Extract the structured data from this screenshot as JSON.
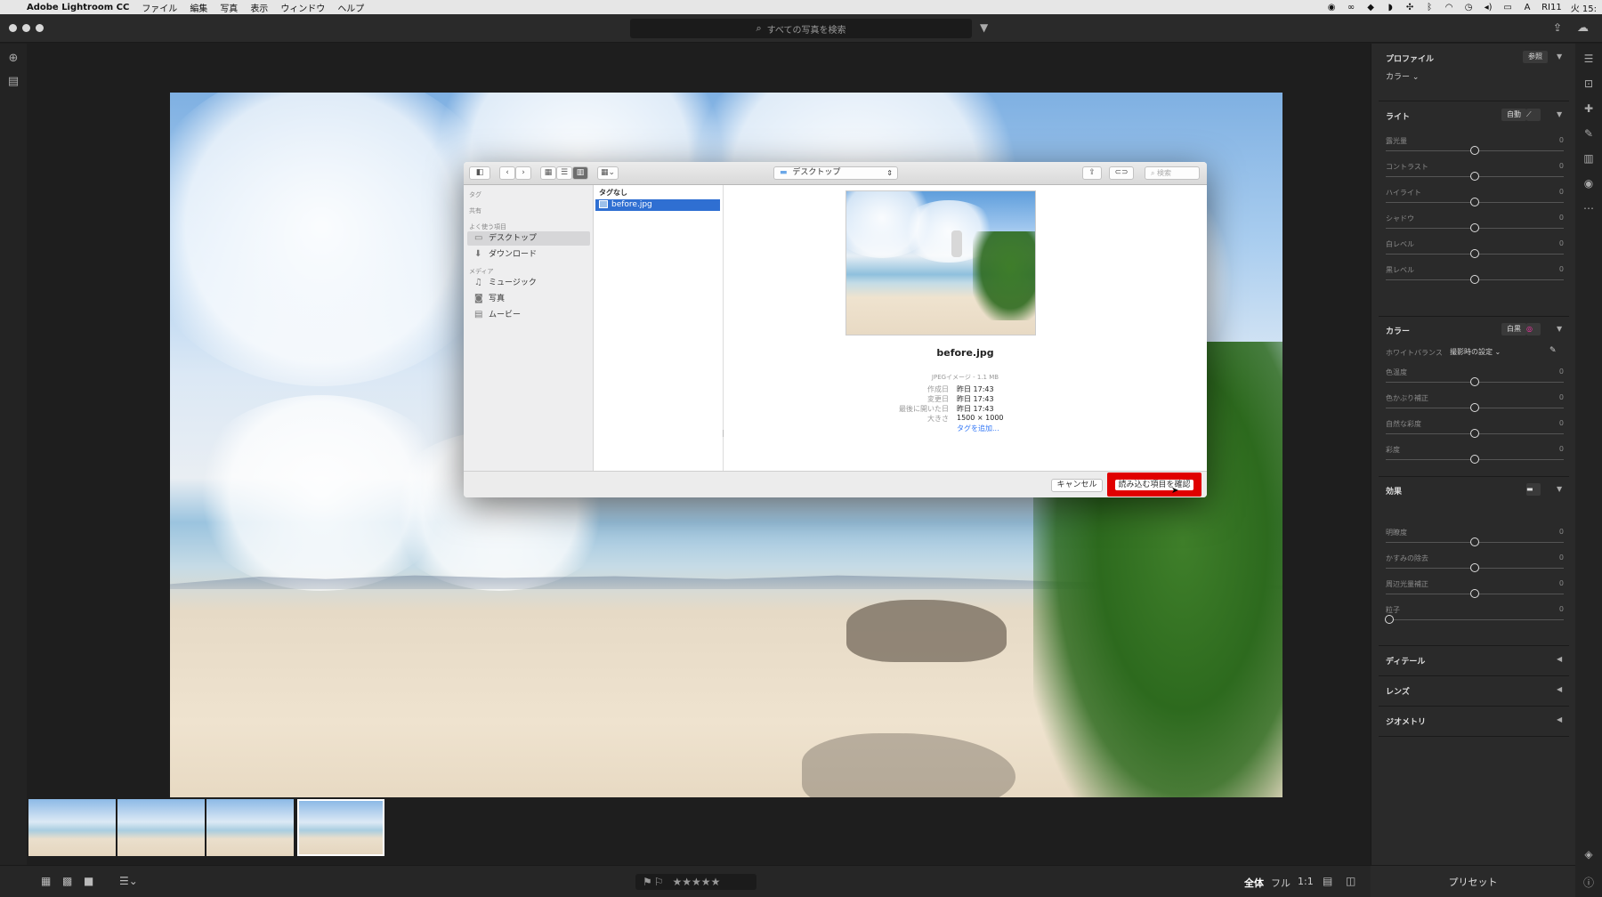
{
  "menubar": {
    "app_name": "Adobe Lightroom CC",
    "menus": [
      "ファイル",
      "編集",
      "写真",
      "表示",
      "ウィンドウ",
      "ヘルプ"
    ],
    "status_text": "RI11",
    "clock": "火 15:"
  },
  "titlebar": {
    "search_placeholder": "すべての写真を検索"
  },
  "bottombar": {
    "zoom_all": "全体",
    "zoom_fill": "フル",
    "zoom_1to1": "1:1",
    "stars": "★★★★★"
  },
  "right_panel": {
    "profile": {
      "title": "プロファイル",
      "browse": "参照",
      "value": "カラー ⌄"
    },
    "light": {
      "title": "ライト",
      "auto": "自動",
      "sliders": [
        {
          "label": "露光量",
          "value": "0"
        },
        {
          "label": "コントラスト",
          "value": "0"
        },
        {
          "label": "ハイライト",
          "value": "0"
        },
        {
          "label": "シャドウ",
          "value": "0"
        },
        {
          "label": "白レベル",
          "value": "0"
        },
        {
          "label": "黒レベル",
          "value": "0"
        }
      ]
    },
    "color": {
      "title": "カラー",
      "bw": "白黒",
      "wb_label": "ホワイトバランス",
      "wb_value": "撮影時の設定 ⌄",
      "sliders": [
        {
          "label": "色温度",
          "value": "0"
        },
        {
          "label": "色かぶり補正",
          "value": "0"
        },
        {
          "label": "自然な彩度",
          "value": "0"
        },
        {
          "label": "彩度",
          "value": "0"
        }
      ]
    },
    "effects": {
      "title": "効果",
      "sliders": [
        {
          "label": "明瞭度",
          "value": "0"
        },
        {
          "label": "かすみの除去",
          "value": "0"
        },
        {
          "label": "周辺光量補正",
          "value": "0"
        },
        {
          "label": "粒子",
          "value": "0"
        }
      ]
    },
    "detail": "ディテール",
    "lens": "レンズ",
    "geometry": "ジオメトリ",
    "presets": "プリセット"
  },
  "dialog": {
    "location": "デスクトップ",
    "search_placeholder": "検索",
    "sidebar": {
      "tags": "タグ",
      "shared": "共有",
      "favorites": "よく使う項目",
      "fav_items": [
        "デスクトップ",
        "ダウンロード"
      ],
      "media": "メディア",
      "media_items": [
        "ミュージック",
        "写真",
        "ムービー"
      ]
    },
    "column_header": "タグなし",
    "file_name": "before.jpg",
    "preview": {
      "name": "before.jpg",
      "kind": "JPEGイメージ - 1.1 MB",
      "meta": [
        {
          "key": "作成日",
          "value": "昨日 17:43"
        },
        {
          "key": "変更日",
          "value": "昨日 17:43"
        },
        {
          "key": "最後に開いた日",
          "value": "昨日 17:43"
        },
        {
          "key": "大きさ",
          "value": "1500 × 1000"
        }
      ],
      "add_tag": "タグを追加..."
    },
    "cancel": "キャンセル",
    "confirm": "読み込む項目を確認"
  }
}
